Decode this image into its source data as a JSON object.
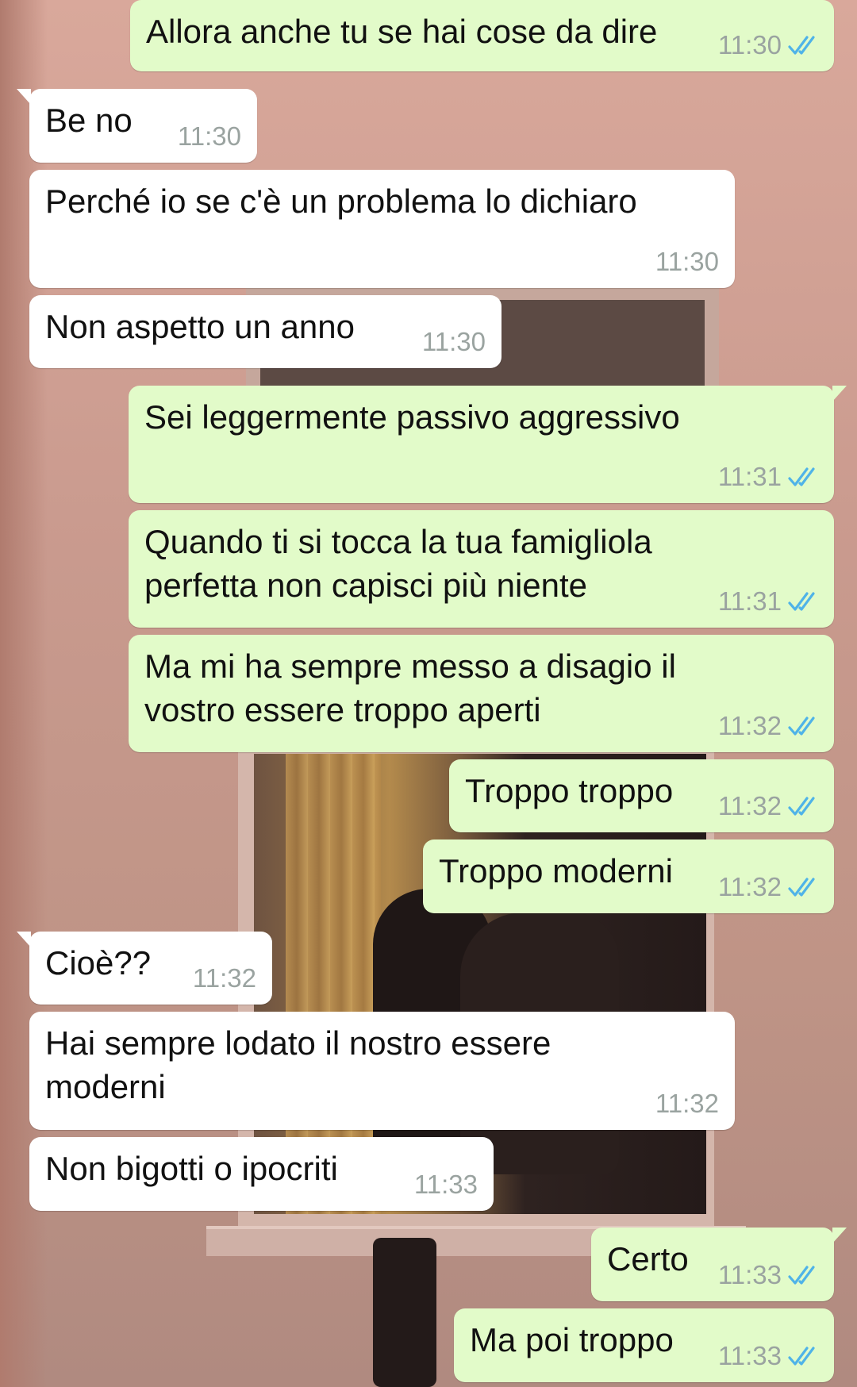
{
  "conversation": {
    "messages": [
      {
        "side": "out",
        "text": "Allora anche tu se hai cose da dire",
        "time": "11:30",
        "read": true
      },
      {
        "side": "in",
        "text": "Be no",
        "time": "11:30",
        "tail": true
      },
      {
        "side": "in",
        "text": "Perché io se c'è un problema lo dichiaro",
        "time": "11:30"
      },
      {
        "side": "in",
        "text": "Non aspetto un anno",
        "time": "11:30"
      },
      {
        "side": "out",
        "text": "Sei leggermente passivo aggressivo",
        "time": "11:31",
        "read": true,
        "tail": true
      },
      {
        "side": "out",
        "text": "Quando ti si tocca la tua famigliola\nperfetta non capisci più niente",
        "time": "11:31",
        "read": true
      },
      {
        "side": "out",
        "text": "Ma mi ha sempre messo a disagio il\nvostro essere troppo aperti",
        "time": "11:32",
        "read": true
      },
      {
        "side": "out",
        "text": "Troppo troppo",
        "time": "11:32",
        "read": true
      },
      {
        "side": "out",
        "text": "Troppo moderni",
        "time": "11:32",
        "read": true
      },
      {
        "side": "in",
        "text": "Cioè??",
        "time": "11:32",
        "tail": true
      },
      {
        "side": "in",
        "text": "Hai sempre lodato il nostro essere\nmoderni",
        "time": "11:32"
      },
      {
        "side": "in",
        "text": "Non bigotti o ipocriti",
        "time": "11:33"
      },
      {
        "side": "out",
        "text": "Certo",
        "time": "11:33",
        "read": true,
        "tail": true
      },
      {
        "side": "out",
        "text": "Ma poi troppo",
        "time": "11:33",
        "read": true
      }
    ]
  },
  "colors": {
    "incoming_bubble": "#ffffff",
    "outgoing_bubble": "#e2fbc9",
    "timestamp": "#9aa3a0",
    "read_ticks": "#4fb3e8"
  },
  "icons": {
    "read_receipt": "double-check-icon"
  }
}
